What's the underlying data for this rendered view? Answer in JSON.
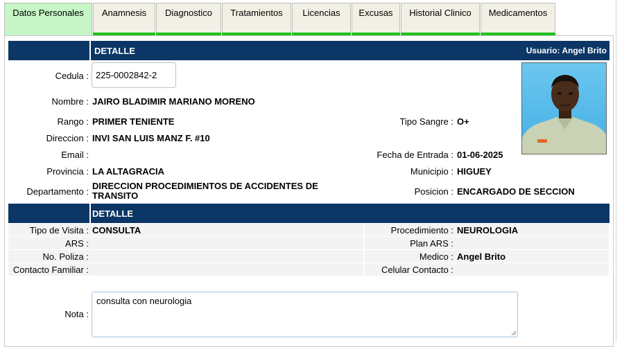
{
  "tabs": [
    {
      "label": "Datos Personales",
      "active": true
    },
    {
      "label": "Anamnesis"
    },
    {
      "label": "Diagnostico"
    },
    {
      "label": "Tratamientos"
    },
    {
      "label": "Licencias"
    },
    {
      "label": "Excusas"
    },
    {
      "label": "Historial Clinico"
    },
    {
      "label": "Medicamentos"
    }
  ],
  "header": {
    "title": "DETALLE",
    "user": "Usuario: Angel Brito"
  },
  "personal": {
    "cedula_label": "Cedula :",
    "cedula": "225-0002842-2",
    "nombre_label": "Nombre :",
    "nombre": "JAIRO BLADIMIR MARIANO MORENO",
    "rango_label": "Rango :",
    "rango": "PRIMER TENIENTE",
    "tipo_sangre_label": "Tipo Sangre :",
    "tipo_sangre": "O+",
    "direccion_label": "Direccion :",
    "direccion": "INVI SAN LUIS MANZ F. #10",
    "email_label": "Email :",
    "email": "",
    "fecha_entrada_label": "Fecha de Entrada :",
    "fecha_entrada": "01-06-2025",
    "provincia_label": "Provincia :",
    "provincia": "LA ALTAGRACIA",
    "municipio_label": "Municipio :",
    "municipio": "HIGUEY",
    "departamento_label": "Departamento :",
    "departamento": "DIRECCION PROCEDIMIENTOS DE ACCIDENTES DE TRANSITO",
    "posicion_label": "Posicion :",
    "posicion": "ENCARGADO DE SECCION"
  },
  "visit_header": {
    "title": "DETALLE"
  },
  "visit": {
    "tipo_visita_label": "Tipo de Visita :",
    "tipo_visita": "CONSULTA",
    "procedimiento_label": "Procedimiento :",
    "procedimiento": "NEUROLOGIA",
    "ars_label": "ARS :",
    "ars": "",
    "plan_ars_label": "Plan ARS :",
    "plan_ars": "",
    "poliza_label": "No. Poliza :",
    "poliza": "",
    "medico_label": "Medico :",
    "medico": "Angel Brito",
    "contacto_label": "Contacto Familiar :",
    "contacto": "",
    "celular_label": "Celular Contacto :",
    "celular": ""
  },
  "nota": {
    "label": "Nota :",
    "value": "consulta con neurologia"
  },
  "colors": {
    "header_bar": "#0c3665",
    "tab_underline": "#1fc01f",
    "active_tab": "#c6f5c6"
  }
}
